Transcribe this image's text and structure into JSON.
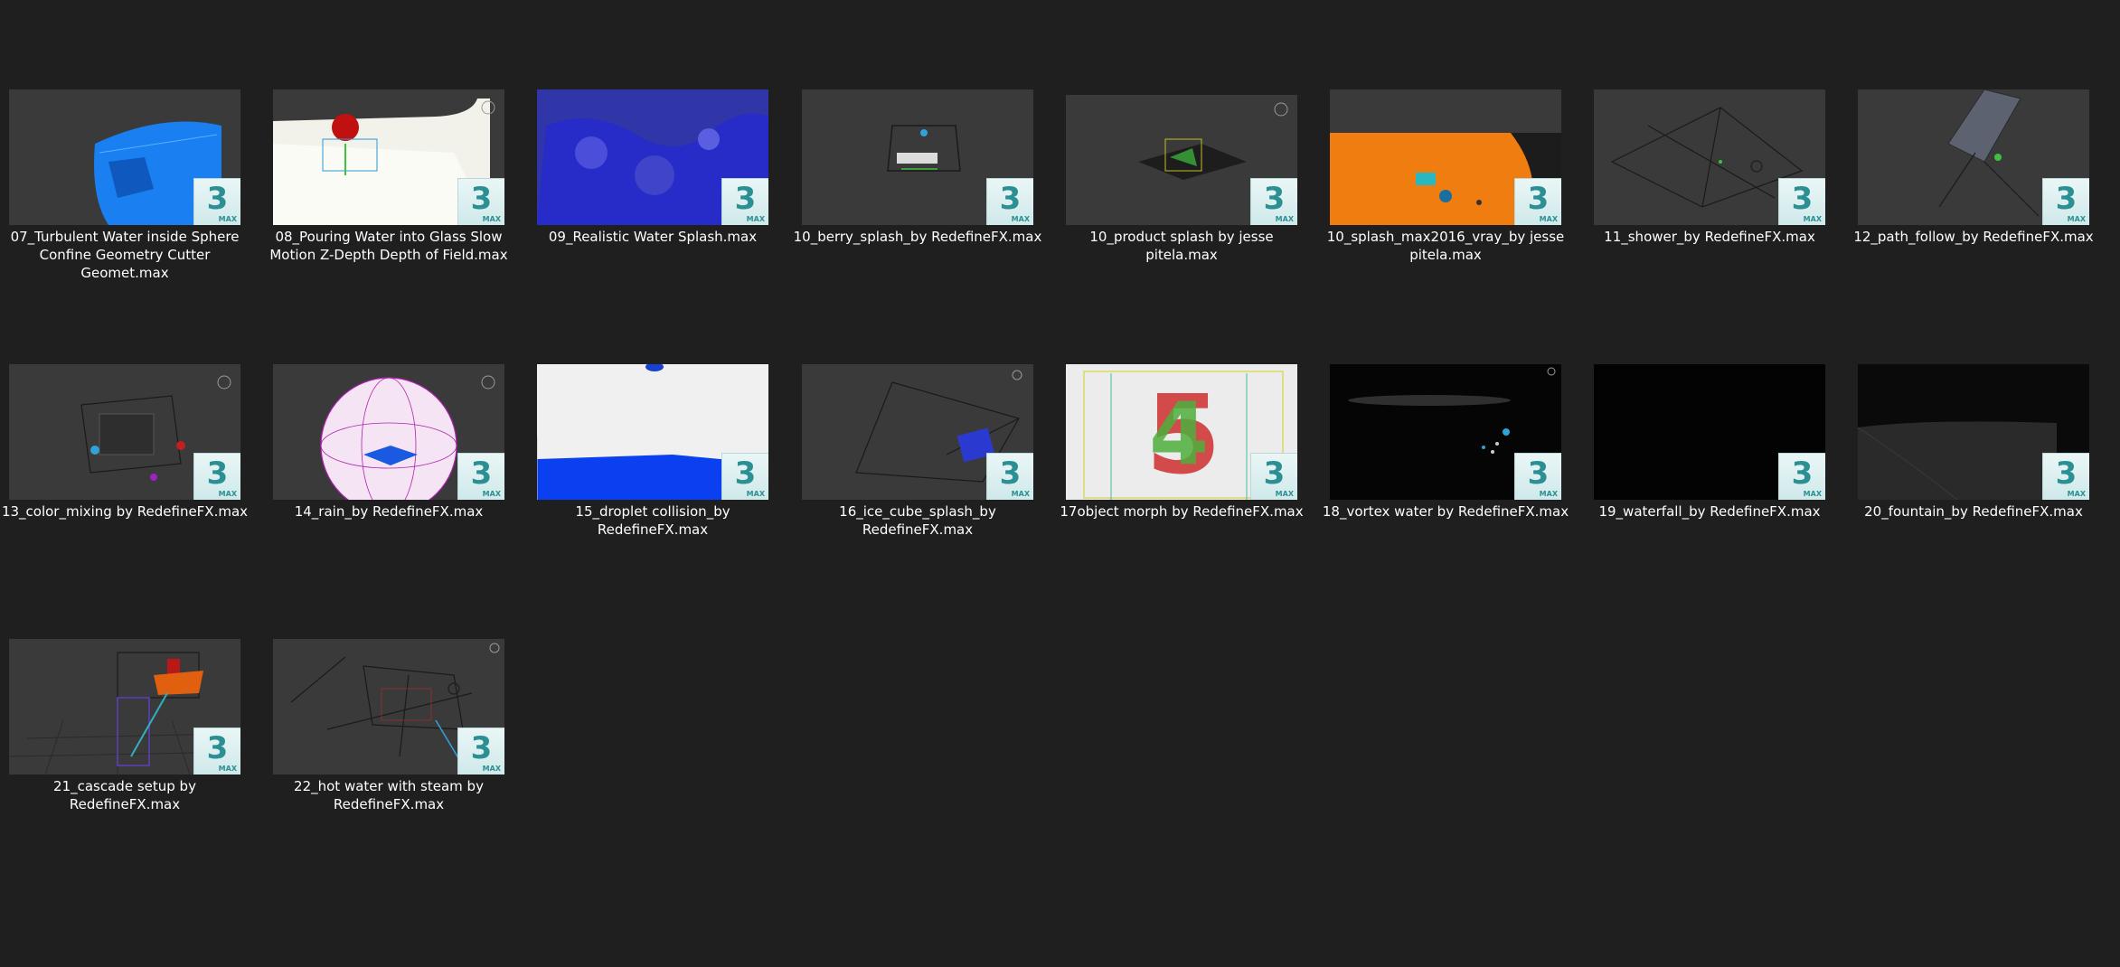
{
  "badge": {
    "number": "3",
    "extension": "MAX",
    "colors": {
      "badge_bg": "#dff0f1",
      "badge_text": "#2b8f94"
    }
  },
  "colors": {
    "background": "#1f1f1f",
    "text": "#ffffff"
  },
  "files": [
    {
      "name": "07_Turbulent Water inside Sphere Confine Geometry Cutter Geomet.max",
      "thumb_bg": "#3a3a3a",
      "icon": "max-file-icon"
    },
    {
      "name": "08_Pouring Water into Glass Slow Motion Z-Depth Depth of Field.max",
      "thumb_bg": "#3a3a3a",
      "icon": "max-file-icon"
    },
    {
      "name": "09_Realistic Water Splash.max",
      "thumb_bg": "#2a2e8a",
      "icon": "max-file-icon"
    },
    {
      "name": "10_berry_splash_by RedefineFX.max",
      "thumb_bg": "#3a3a3a",
      "icon": "max-file-icon"
    },
    {
      "name": "10_product splash by jesse pitela.max",
      "thumb_bg": "#3a3a3a",
      "icon": "max-file-icon"
    },
    {
      "name": "10_splash_max2016_vray_by jesse pitela.max",
      "thumb_bg": "#f07d10",
      "icon": "max-file-icon"
    },
    {
      "name": "11_shower_by RedefineFX.max",
      "thumb_bg": "#3a3a3a",
      "icon": "max-file-icon"
    },
    {
      "name": "12_path_follow_by RedefineFX.max",
      "thumb_bg": "#3a3a3a",
      "icon": "max-file-icon"
    },
    {
      "name": "13_color_mixing by RedefineFX.max",
      "thumb_bg": "#3a3a3a",
      "icon": "max-file-icon"
    },
    {
      "name": "14_rain_by RedefineFX.max",
      "thumb_bg": "#3a3a3a",
      "icon": "max-file-icon"
    },
    {
      "name": "15_droplet collision_by RedefineFX.max",
      "thumb_bg": "#eeeeee",
      "icon": "max-file-icon"
    },
    {
      "name": "16_ice_cube_splash_by RedefineFX.max",
      "thumb_bg": "#3a3a3a",
      "icon": "max-file-icon"
    },
    {
      "name": "17object morph by RedefineFX.max",
      "thumb_bg": "#e8e8e8",
      "icon": "max-file-icon"
    },
    {
      "name": "18_vortex water by RedefineFX.max",
      "thumb_bg": "#050505",
      "icon": "max-file-icon"
    },
    {
      "name": "19_waterfall_by RedefineFX.max",
      "thumb_bg": "#020202",
      "icon": "max-file-icon"
    },
    {
      "name": "20_fountain_by RedefineFX.max",
      "thumb_bg": "#0a0a0a",
      "icon": "max-file-icon"
    },
    {
      "name": "21_cascade setup by RedefineFX.max",
      "thumb_bg": "#3a3a3a",
      "icon": "max-file-icon"
    },
    {
      "name": "22_hot water with steam by RedefineFX.max",
      "thumb_bg": "#3a3a3a",
      "icon": "max-file-icon"
    }
  ]
}
